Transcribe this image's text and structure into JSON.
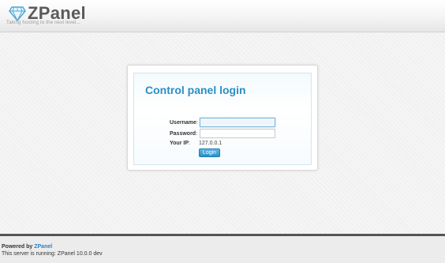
{
  "header": {
    "logo_text": "ZPanel",
    "tagline": "Taking hosting to the next level..."
  },
  "login": {
    "title": "Control panel login",
    "username_label": "Username",
    "password_label": "Password",
    "ip_label": "Your IP",
    "colon": ":",
    "username_value": "",
    "password_value": "",
    "ip_value": "127.0.0.1",
    "login_button": "Login"
  },
  "footer": {
    "powered_by": "Powered by ",
    "powered_brand": "ZPanel",
    "server_info": "This server is running: ZPanel 10.0.0 dev"
  },
  "colors": {
    "accent": "#2b8fc4",
    "footer_border": "#555555"
  }
}
